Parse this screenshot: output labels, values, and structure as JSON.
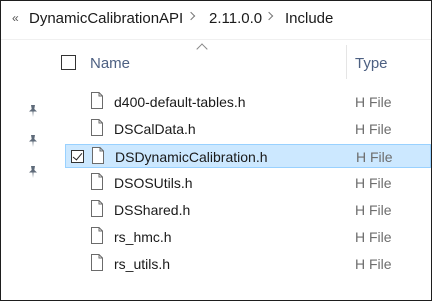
{
  "breadcrumb": {
    "back_glyph": "«",
    "segments": [
      "DynamicCalibrationAPI",
      "2.11.0.0",
      "Include"
    ]
  },
  "columns": {
    "name": "Name",
    "type": "Type"
  },
  "files": [
    {
      "name": "d400-default-tables.h",
      "type": "H File",
      "selected": false
    },
    {
      "name": "DSCalData.h",
      "type": "H File",
      "selected": false
    },
    {
      "name": "DSDynamicCalibration.h",
      "type": "H File",
      "selected": true
    },
    {
      "name": "DSOSUtils.h",
      "type": "H File",
      "selected": false
    },
    {
      "name": "DSShared.h",
      "type": "H File",
      "selected": false
    },
    {
      "name": "rs_hmc.h",
      "type": "H File",
      "selected": false
    },
    {
      "name": "rs_utils.h",
      "type": "H File",
      "selected": false
    }
  ],
  "colors": {
    "selection_bg": "#cce8ff",
    "selection_border": "#99d1ff",
    "header_text": "#4d6082"
  }
}
